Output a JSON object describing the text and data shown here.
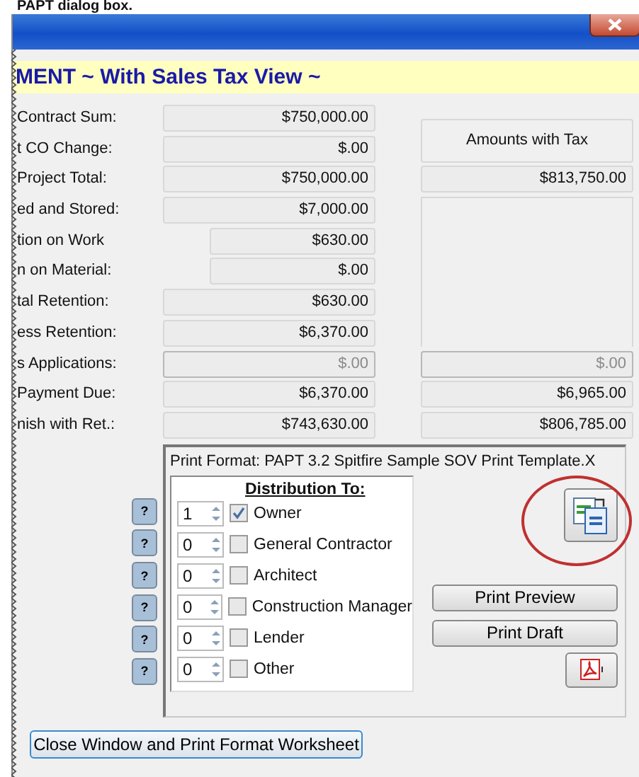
{
  "caption": "PAPT dialog box.",
  "banner": "MENT ~ With Sales Tax View ~",
  "tax_heading": "Amounts with Tax",
  "rows": [
    {
      "label": "Contract Sum:",
      "value": "$750,000.00",
      "kind": "main",
      "disabled": false
    },
    {
      "label": "t CO Change:",
      "value": "$.00",
      "kind": "main",
      "disabled": false
    },
    {
      "label": "Project Total:",
      "value": "$750,000.00",
      "kind": "main",
      "disabled": false,
      "with_tax": "$813,750.00"
    },
    {
      "label": "ed and Stored:",
      "value": "$7,000.00",
      "kind": "main",
      "disabled": false
    },
    {
      "label": "tion on Work",
      "value": "$630.00",
      "kind": "sub",
      "disabled": false
    },
    {
      "label": "n on Material:",
      "value": "$.00",
      "kind": "sub",
      "disabled": false
    },
    {
      "label": "tal Retention:",
      "value": "$630.00",
      "kind": "main",
      "disabled": false
    },
    {
      "label": "ess Retention:",
      "value": "$6,370.00",
      "kind": "main",
      "disabled": false
    },
    {
      "label": "s Applications:",
      "value": "$.00",
      "kind": "main",
      "disabled": true,
      "with_tax": "$.00"
    },
    {
      "label": "Payment Due:",
      "value": "$6,370.00",
      "kind": "main",
      "disabled": false,
      "with_tax": "$6,965.00"
    },
    {
      "label": "nish with Ret.:",
      "value": "$743,630.00",
      "kind": "main",
      "disabled": false,
      "with_tax": "$806,785.00"
    }
  ],
  "print": {
    "title": "Print Format: PAPT 3.2 Spitfire Sample SOV Print Template.X",
    "distribution_heading": "Distribution To:",
    "recipients": [
      {
        "help": "?",
        "copies": "1",
        "label": "Owner",
        "checked": true
      },
      {
        "help": "?",
        "copies": "0",
        "label": "General Contractor",
        "checked": false
      },
      {
        "help": "?",
        "copies": "0",
        "label": "Architect",
        "checked": false
      },
      {
        "help": "?",
        "copies": "0",
        "label": "Construction Manager",
        "checked": false
      },
      {
        "help": "?",
        "copies": "0",
        "label": "Lender",
        "checked": false
      },
      {
        "help": "?",
        "copies": "0",
        "label": "Other",
        "checked": false
      }
    ],
    "buttons": [
      "Print Preview",
      "Print Draft"
    ],
    "highlighted": true
  },
  "close_button": "Close Window and Print Format Worksheet"
}
